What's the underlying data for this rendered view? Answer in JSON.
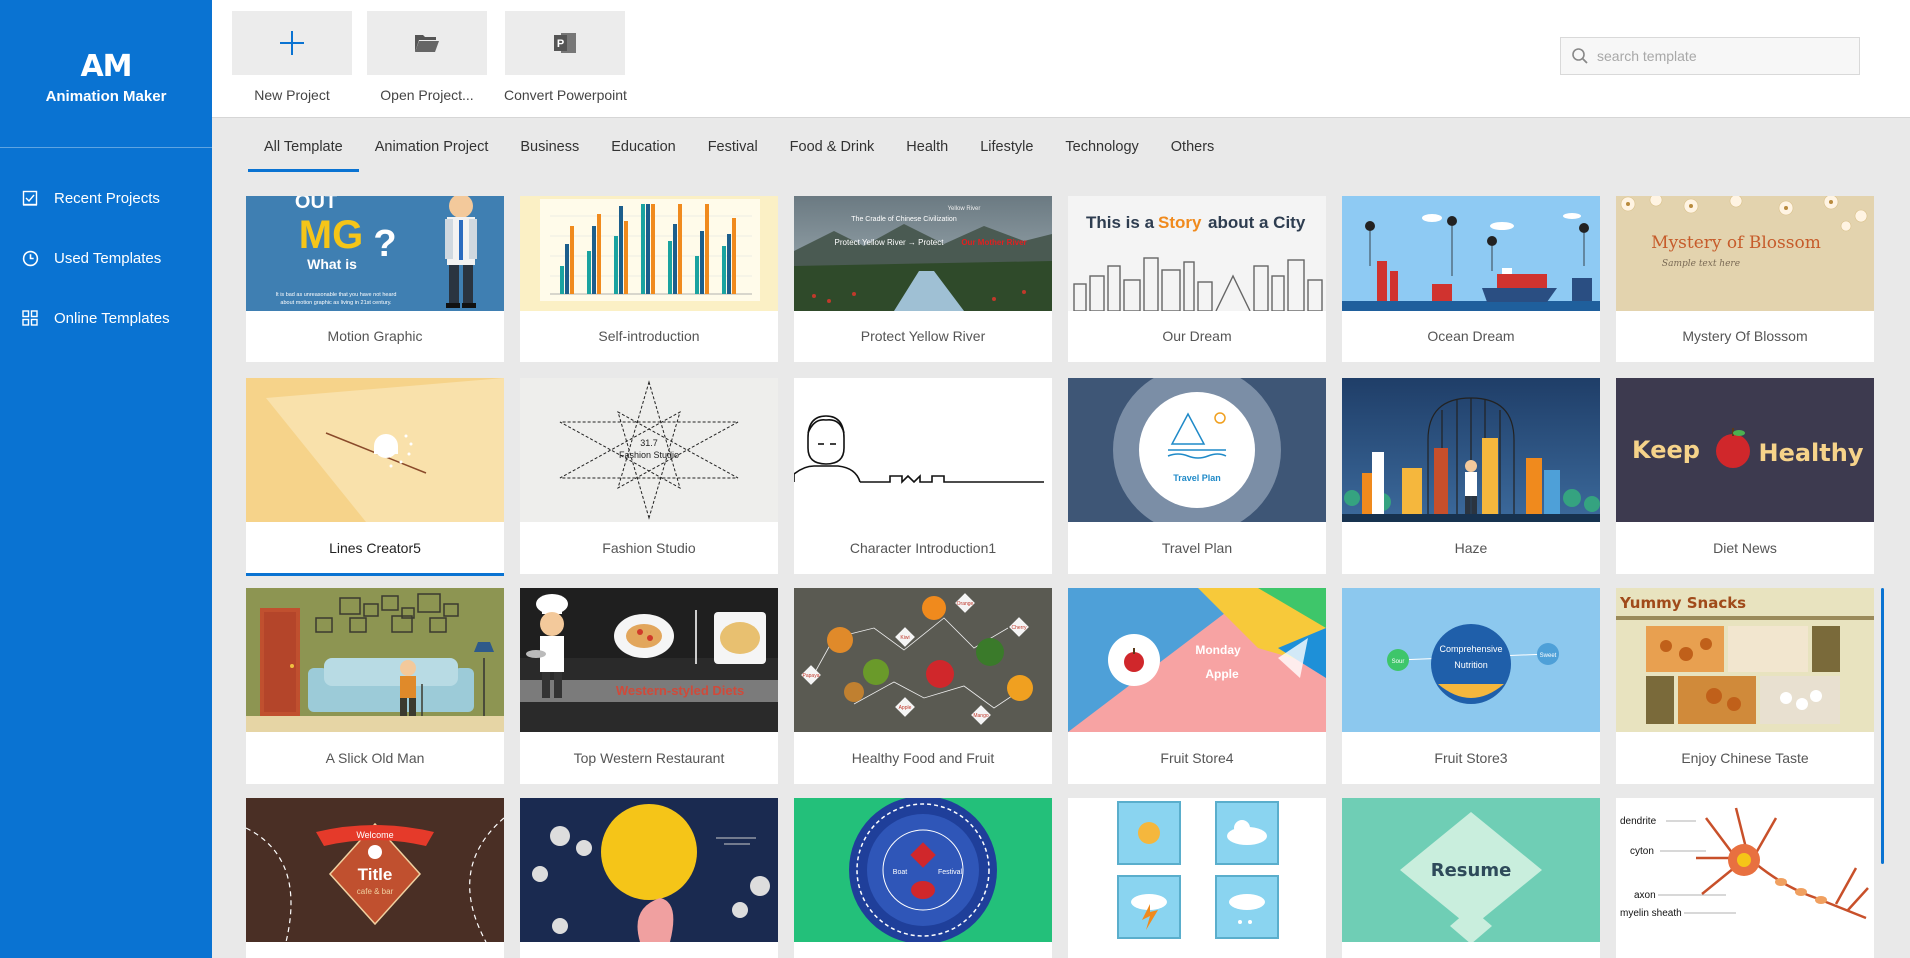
{
  "app": {
    "logo_mark": "AM",
    "logo_name": "Animation Maker"
  },
  "sidebar": {
    "items": [
      {
        "label": "Recent Projects",
        "icon": "recent-projects-icon"
      },
      {
        "label": "Used Templates",
        "icon": "clock-icon"
      },
      {
        "label": "Online Templates",
        "icon": "grid-icon"
      }
    ]
  },
  "toolbar": {
    "new_project": "New Project",
    "open_project": "Open Project...",
    "convert_powerpoint": "Convert Powerpoint"
  },
  "search": {
    "placeholder": "search template"
  },
  "tabs": [
    "All Template",
    "Animation Project",
    "Business",
    "Education",
    "Festival",
    "Food & Drink",
    "Health",
    "Lifestyle",
    "Technology",
    "Others"
  ],
  "active_tab": "All Template",
  "templates": {
    "row1": [
      "Motion Graphic",
      "Self-introduction",
      "Protect Yellow River",
      "Our Dream",
      "Ocean Dream",
      "Mystery Of Blossom"
    ],
    "row2": [
      "Lines Creator5",
      "Fashion Studio",
      "Character Introduction1",
      "Travel Plan",
      "Haze",
      "Diet News"
    ],
    "row3": [
      "A Slick Old Man",
      "Top Western Restaurant",
      "Healthy Food and Fruit",
      "Fruit Store4",
      "Fruit Store3",
      "Enjoy Chinese Taste"
    ]
  },
  "thumb_text": {
    "mg_out": "OUT",
    "mg": "MG",
    "mg_whatis": "What is",
    "mg_body_1": "It is bad as unreasonable that you have not heard",
    "mg_body_2": "about motion graphic as living in 21st century.",
    "river_1": "Yellow River",
    "river_2": "The Cradle of Chinese Civilization",
    "river_3": "Protect Yellow River  →  Protect",
    "river_4": "Our Mother River",
    "city_1": "This is a",
    "city_2": "Story",
    "city_3": "about a City",
    "blossom_title": "Mystery of Blossom",
    "blossom_sub": "Sample text here",
    "fashion_1": "31.7",
    "fashion_2": "Fashion Studio",
    "travel": "Travel Plan",
    "keep": "Keep",
    "healthy": "Healthy",
    "western": "Western-styled Diets",
    "fruit_labels": [
      "Orange",
      "Kiwi",
      "Cherry",
      "Papaya",
      "Apple",
      "Mango"
    ],
    "monday": "Monday",
    "apple": "Apple",
    "fs3_center_1": "Comprehensive",
    "fs3_center_2": "Nutrition",
    "fs3_left": "Sour",
    "fs3_right": "Sweet",
    "snacks": "Yummy Snacks",
    "welcome": "Welcome",
    "title": "Title",
    "cafe": "cafe & bar",
    "boat": "Boat",
    "festival": "Festival",
    "resume": "Resume",
    "neuron": [
      "dendrite",
      "cyton",
      "axon",
      "myelin sheath"
    ]
  },
  "colors": {
    "accent": "#0a73d2"
  }
}
